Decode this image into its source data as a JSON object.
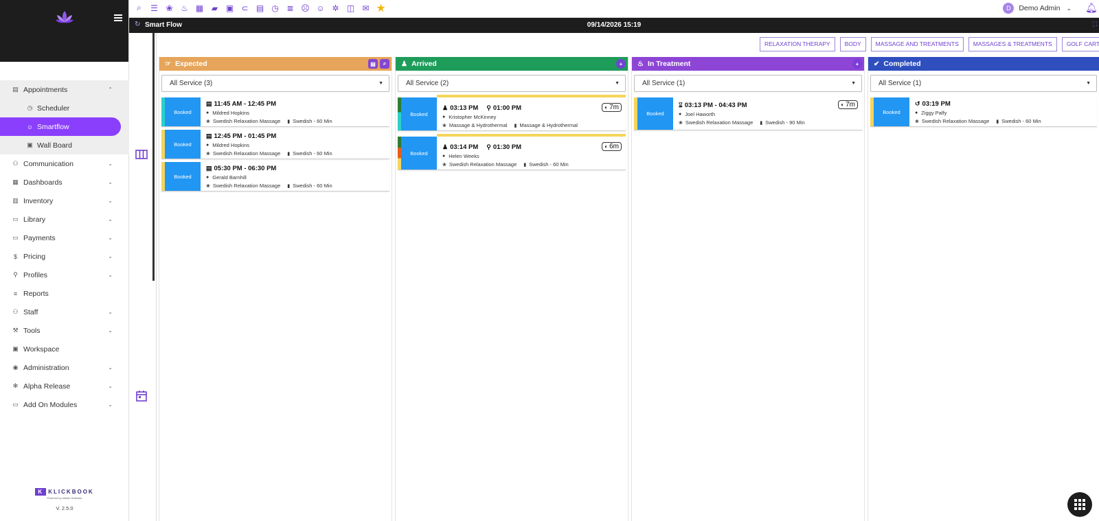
{
  "topbar": {
    "tool_icons": [
      "search-icon",
      "sliders-icon",
      "lotus-icon",
      "spa-icon",
      "apps-icon",
      "briefcase-icon",
      "money-icon",
      "ticket-icon",
      "calendar-icon",
      "clock-icon",
      "list-icon",
      "face-icon",
      "smile-icon",
      "bug-icon",
      "board-icon",
      "chat-icon",
      "star-icon"
    ],
    "user_initial": "D",
    "user_name": "Demo Admin"
  },
  "titlebar": {
    "title": "Smart Flow",
    "datetime": "09/14/2026 15:19"
  },
  "sidebar": {
    "items": [
      {
        "label": "Appointments",
        "expanded": true
      },
      {
        "label": "Communication"
      },
      {
        "label": "Dashboards"
      },
      {
        "label": "Inventory"
      },
      {
        "label": "Library"
      },
      {
        "label": "Payments"
      },
      {
        "label": "Pricing"
      },
      {
        "label": "Profiles"
      },
      {
        "label": "Reports"
      },
      {
        "label": "Staff"
      },
      {
        "label": "Tools"
      },
      {
        "label": "Workspace"
      },
      {
        "label": "Administration"
      },
      {
        "label": "Alpha Release"
      },
      {
        "label": "Add On Modules"
      }
    ],
    "sub_items": [
      {
        "label": "Scheduler"
      },
      {
        "label": "Smartflow",
        "active": true
      },
      {
        "label": "Wall Board"
      }
    ],
    "brand": "KLICKBOOK",
    "brand_mark": "K",
    "brand_sub": "Powered by Infinite Software",
    "version": "V. 2.5.0"
  },
  "filters": [
    "RELAXATION THERAPY",
    "BODY",
    "MASSAGE AND TREATMENTS",
    "MASSAGES & TREATMENTS",
    "GOLF CART"
  ],
  "columns": [
    {
      "title": "Expected",
      "color": "#e6a55a",
      "select": "All Service (3)",
      "cards": [
        {
          "status": "Booked",
          "time": "11:45 AM - 12:45 PM",
          "client": "Mildred Hopkins",
          "service": "Swedish Relaxation Massage",
          "variant": "Swedish - 60 Min",
          "stripe": "#2ad1c9"
        },
        {
          "status": "Booked",
          "time": "12:45 PM - 01:45 PM",
          "client": "Mildred Hopkins",
          "service": "Swedish Relaxation Massage",
          "variant": "Swedish - 60 Min",
          "stripe": "#f5d55a"
        },
        {
          "status": "Booked",
          "time": "05:30 PM - 06:30 PM",
          "client": "Gerald Barnhill",
          "service": "Swedish Relaxation Massage",
          "variant": "Swedish - 60 Min",
          "stripe": "#f5d55a"
        }
      ]
    },
    {
      "title": "Arrived",
      "color": "#1e9c5a",
      "select": "All Service (2)",
      "cards": [
        {
          "status": "Booked",
          "time": "03:13 PM",
          "time2": "01:00 PM",
          "client": "Kristopher McKinney",
          "service": "Massage & Hydrothermal",
          "variant": "Massage & Hydrothermal",
          "timer": "7m"
        },
        {
          "status": "Booked",
          "time": "03:14 PM",
          "time2": "01:30 PM",
          "client": "Helen Weeks",
          "service": "Swedish Relaxation Massage",
          "variant": "Swedish - 60 Min",
          "timer": "6m"
        }
      ]
    },
    {
      "title": "In Treatment",
      "color": "#8d45d6",
      "select": "All Service (1)",
      "cards": [
        {
          "status": "Booked",
          "time": "03:13 PM - 04:43 PM",
          "client": "Joel Haworth",
          "service": "Swedish Relaxation Massage",
          "variant": "Swedish - 90 Min",
          "timer": "7m"
        }
      ]
    },
    {
      "title": "Completed",
      "color": "#2f4fbf",
      "select": "All Service (1)",
      "cards": [
        {
          "status": "Booked",
          "time": "03:19 PM",
          "client": "Ziggy Palfy",
          "service": "Swedish Relaxation Massage",
          "variant": "Swedish - 60 Min"
        }
      ]
    }
  ]
}
